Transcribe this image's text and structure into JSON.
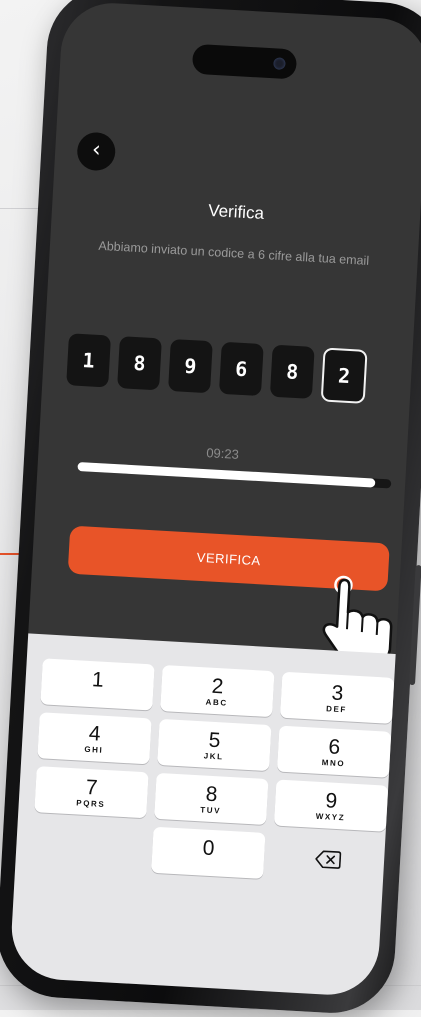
{
  "screen": {
    "title": "Verifica",
    "subtitle": "Abbiamo inviato un codice a 6 cifre alla tua email",
    "back_icon": "chevron-left-icon",
    "otp_digits": [
      "1",
      "8",
      "9",
      "6",
      "8",
      "2"
    ],
    "active_digit_index": 5,
    "timer": "09:23",
    "timer_progress": 0.95,
    "verify_button_label": "VERIFICA",
    "accent_color": "#e85428"
  },
  "keyboard": {
    "keys": [
      {
        "num": "1",
        "letters": ""
      },
      {
        "num": "2",
        "letters": "ABC"
      },
      {
        "num": "3",
        "letters": "DEF"
      },
      {
        "num": "4",
        "letters": "GHI"
      },
      {
        "num": "5",
        "letters": "JKL"
      },
      {
        "num": "6",
        "letters": "MNO"
      },
      {
        "num": "7",
        "letters": "PQRS"
      },
      {
        "num": "8",
        "letters": "TUV"
      },
      {
        "num": "9",
        "letters": "WXYZ"
      },
      {
        "num": "0",
        "letters": ""
      }
    ],
    "delete_icon": "backspace-icon"
  }
}
